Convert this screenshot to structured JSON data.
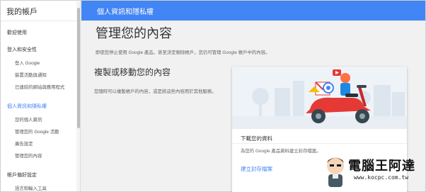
{
  "sidebar": {
    "header": "我的帳戶",
    "sections": [
      {
        "label": "歡迎使用"
      },
      {
        "label": "登入和安全性"
      },
      {
        "label": "個人資訊和隱私權"
      },
      {
        "label": "帳戶偏好設定"
      }
    ],
    "security_items": [
      "登入 Google",
      "裝置活動與通知",
      "已連結的網站與應用程式"
    ],
    "privacy_items": [
      "您的個人資訊",
      "管理您的 Google 活動",
      "廣告設定",
      "管理您的內容"
    ],
    "prefs_items": [
      "語言和輸入工具"
    ]
  },
  "topbar": {
    "title": "個人資訊和隱私權"
  },
  "main": {
    "title": "管理您的內容",
    "intro": "即使您停止使用 Google 產品，甚至決定刪除帳戶，您仍可管理 Google 帳戶中的內容。",
    "section_title": "複製或移動您的內容",
    "section_desc": "您隨時可以複製帳戶的內容，或是將這些內容用於其他服務。",
    "card": {
      "title": "下載您的資料",
      "desc": "為您的 Google 產品資料建立封存檔案。",
      "link": "建立封存檔案"
    }
  },
  "watermark": {
    "text": "電腦王阿達",
    "url": "www.kocpc.com.tw"
  },
  "colors": {
    "accent": "#4285f4",
    "scooter": "#e53935"
  }
}
